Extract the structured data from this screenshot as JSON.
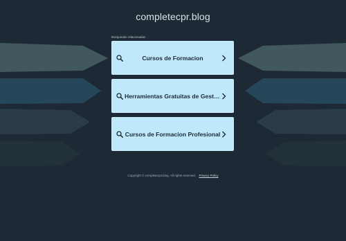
{
  "site": {
    "title": "completecpr.blog"
  },
  "related": {
    "heading": "Búsquedas relacionadas",
    "items": [
      {
        "label": "Cursos de Formacion"
      },
      {
        "label": "Herramientas Gratuitas de Gestión de Proyectos"
      },
      {
        "label": "Cursos de Formacion Profesional"
      }
    ]
  },
  "footer": {
    "copyright": "Copyright © completecpr.blog.  All rights reserved.",
    "privacy_label": "Privacy Policy"
  },
  "colors": {
    "background": "#1d2a35",
    "card": "#bfe8fb",
    "card_text": "#1b2a36"
  }
}
